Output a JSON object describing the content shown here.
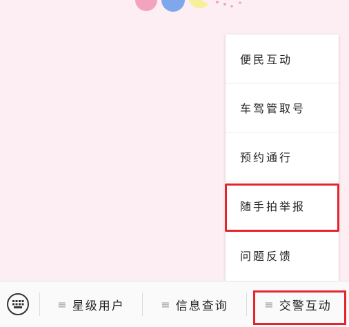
{
  "popup_menu": {
    "items": [
      {
        "label": "便民互动"
      },
      {
        "label": "车驾管取号"
      },
      {
        "label": "预约通行"
      },
      {
        "label": "随手拍举报"
      },
      {
        "label": "问题反馈"
      }
    ],
    "highlighted_index": 3
  },
  "bottom_bar": {
    "keyboard_icon": "keyboard-icon",
    "menu_icon_glyph": "≡",
    "tabs": [
      {
        "label": "星级用户"
      },
      {
        "label": "信息查询"
      },
      {
        "label": "交警互动"
      }
    ],
    "highlighted_index": 2
  },
  "colors": {
    "background": "#fdeef3",
    "highlight_border": "#e5242b"
  }
}
